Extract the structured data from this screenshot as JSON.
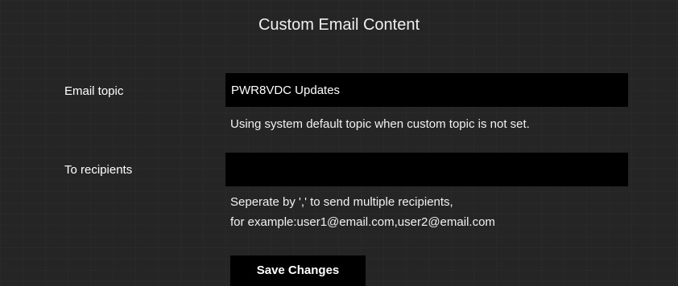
{
  "title": "Custom Email Content",
  "topic": {
    "label": "Email topic",
    "value": "PWR8VDC Updates",
    "hint": "Using system default topic when custom topic is not set."
  },
  "recipients": {
    "label": "To recipients",
    "value": "",
    "hint_line1": "Seperate by ',' to send multiple recipients,",
    "hint_line2": "for example:user1@email.com,user2@email.com"
  },
  "save_button": {
    "label": "Save Changes"
  },
  "colors": {
    "background": "#262626",
    "field_background": "#000000",
    "text": "#ffffff"
  }
}
